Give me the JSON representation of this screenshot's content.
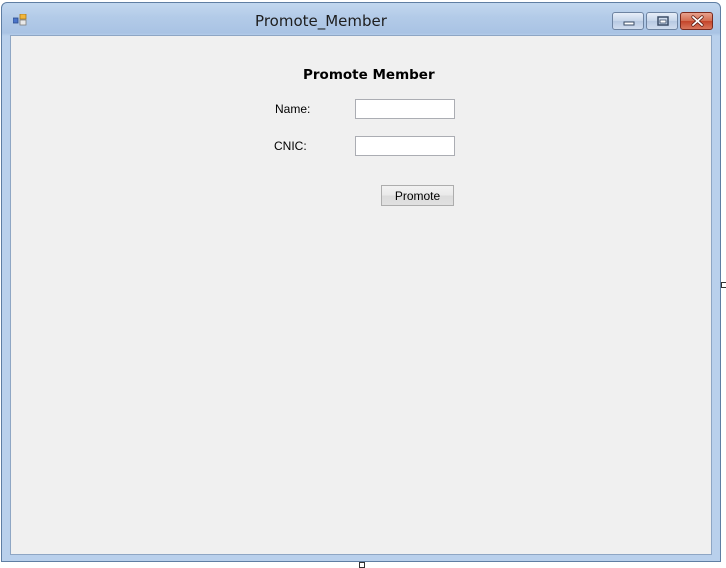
{
  "window": {
    "title": "Promote_Member",
    "controls": {
      "minimize_icon": "minimize-icon",
      "maximize_icon": "maximize-icon",
      "close_icon": "close-icon"
    }
  },
  "form": {
    "heading": "Promote Member",
    "name_label": "Name:",
    "name_value": "",
    "cnic_label": "CNIC:",
    "cnic_value": "",
    "promote_label": "Promote"
  },
  "colors": {
    "titlebar": "#b3cbe8",
    "client_background": "#f0f0f0",
    "close_button": "#c4442a"
  }
}
